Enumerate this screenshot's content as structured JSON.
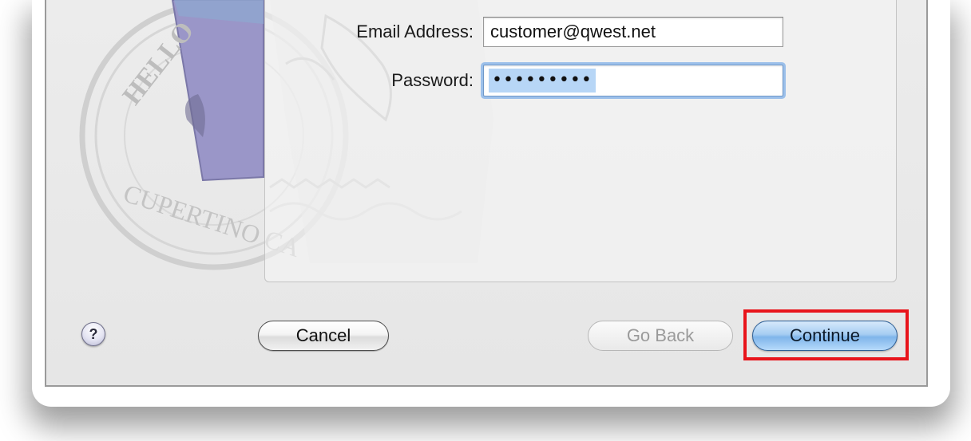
{
  "form": {
    "email_label": "Email Address:",
    "email_value": "customer@qwest.net",
    "password_label": "Password:",
    "password_value": "•••••••••"
  },
  "buttons": {
    "help_label": "?",
    "cancel_label": "Cancel",
    "go_back_label": "Go Back",
    "continue_label": "Continue"
  },
  "stamp": {
    "text_top": "HELLO",
    "text_bottom": "CUPERTINO CA"
  },
  "colors": {
    "highlight": "#e8141b",
    "continue_button": "#7fb5ea",
    "envelope": "#9a96c8"
  }
}
